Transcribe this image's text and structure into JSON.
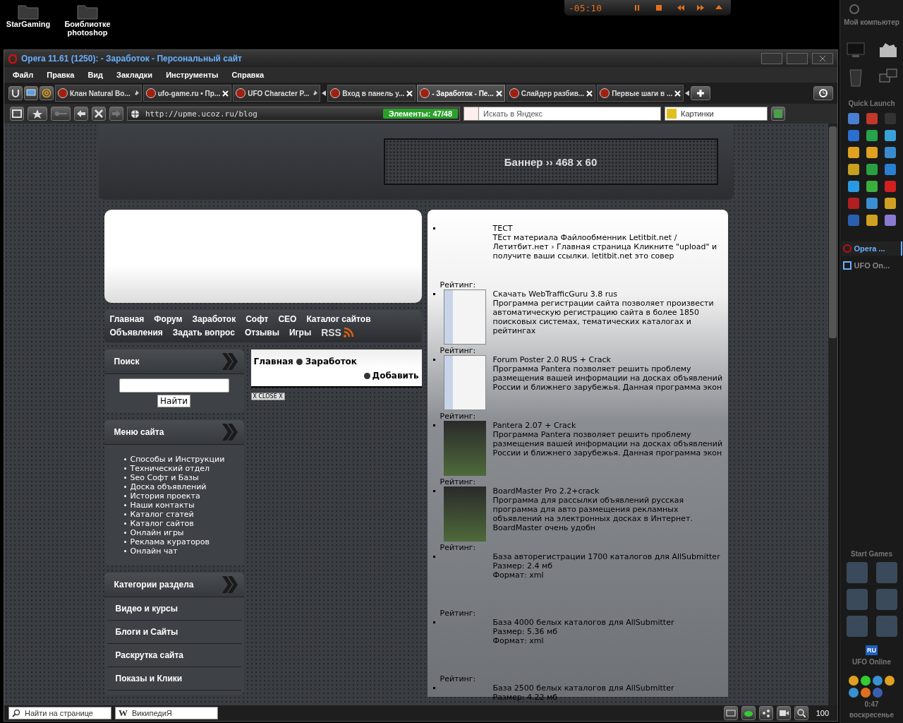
{
  "desktop_icons": [
    {
      "label": "StarGaming"
    },
    {
      "label": "Боиблиотке photoshop"
    }
  ],
  "media_player": {
    "time": "-05:10"
  },
  "window": {
    "title": "Opera 11.61 (1250): - Заработок - Персональный сайт"
  },
  "menu": [
    "Файл",
    "Правка",
    "Вид",
    "Закладки",
    "Инструменты",
    "Справка"
  ],
  "tabs": [
    {
      "label": "Клан Natural Bo...",
      "pinned": true,
      "selected": false
    },
    {
      "label": "ufo-game.ru • Пр...",
      "pinned": false,
      "selected": false
    },
    {
      "label": "UFO Character P...",
      "pinned": true,
      "selected": false
    },
    {
      "label": "Вход в панель у...",
      "pinned": false,
      "selected": false
    },
    {
      "label": "- Заработок - Пе...",
      "pinned": false,
      "selected": true
    },
    {
      "label": "Слайдер разбив...",
      "pinned": false,
      "selected": false
    },
    {
      "label": "Первые шаги в ...",
      "pinned": false,
      "selected": false
    }
  ],
  "address_bar": {
    "url": "http://upme.ucoz.ru/blog",
    "elements": "Элементы:  47/48"
  },
  "search_field": {
    "placeholder": "Искать в Яндекс"
  },
  "images_field": {
    "value": "Картинки"
  },
  "site": {
    "banner": "Баннер  ›› 468 x 60",
    "nav": [
      "Главная",
      "Форум",
      "Заработок",
      "Софт",
      "СЕО",
      "Каталог сайтов",
      "Объявления",
      "Задать вопрос",
      "Отзывы",
      "Игры"
    ],
    "rss": "RSS",
    "search_box": {
      "title": "Поиск",
      "button": "Найти"
    },
    "menu_box": {
      "title": "Меню сайта",
      "items": [
        "Способы и Инструкции",
        "Технический отдел",
        "Seo Софт и Базы",
        "Доска объявлений",
        "История проекта",
        "Наши контакты",
        "Каталог статей",
        "Каталог сайтов",
        "Онлайн игры",
        "Реклама кураторов",
        "Онлайн чат"
      ]
    },
    "categories_box": {
      "title": "Категории раздела",
      "items": [
        "Видео и курсы",
        "Блоги и Сайты",
        "Раскрутка сайта",
        "Показы и Клики"
      ]
    },
    "breadcrumb": [
      "Главная",
      "Заработок"
    ],
    "add_link": "Добавить",
    "close_button": "X CLOSE X",
    "entries": [
      {
        "kind": "text",
        "title": "ТЕСТ",
        "lines": [
          "ТЕст материала Файлообменник Letitbit.net / Летитбит.нет › Главная страница Кликните \"upload\" и получите ваши ссылки. letitbit.net это совер"
        ],
        "rating": "Рейтинг:"
      },
      {
        "kind": "screenshot",
        "title": "Скачать WebTrafficGuru 3.8 rus",
        "lines": [
          "Программа регистрации сайта позволяет произвести автоматическую регистрацию сайта в более 1850 поисковых системах, тематических каталогах и рейтингах"
        ],
        "rating": "Рейтинг:"
      },
      {
        "kind": "screenshot",
        "title": "Forum Poster 2.0 RUS + Crack",
        "lines": [
          "Программа Pantera позволяет решить проблему размещения вашей информации на досках объявлений России и ближнего зарубежья. Данная программа экон"
        ],
        "rating": "Рейтинг:"
      },
      {
        "kind": "photo",
        "title": "Pantera 2.07 + Crack",
        "lines": [
          "Программа Pantera позволяет решить проблему размещения вашей информации на досках объявлений России и ближнего зарубежья. Данная программа экон"
        ],
        "rating": "Рейтинг:"
      },
      {
        "kind": "photo",
        "title": "BoardMaster Pro 2.2+crack",
        "lines": [
          "Программа для рассылки объявлений русская программа для авто размещения рекламных объявлений на электронных досках в Интернет. BoardMaster очень удобн"
        ],
        "rating": "Рейтинг:"
      },
      {
        "kind": "text",
        "title": "База авторегистрации 1700 каталогов для AllSubmitter",
        "lines": [
          "Размер: 2.4 мб",
          "Формат: xml"
        ],
        "rating": "Рейтинг:"
      },
      {
        "kind": "text",
        "title": "База 4000 белых каталогов для AllSubmitter",
        "lines": [
          "Размер: 5.36 мб",
          "Формат: xml"
        ],
        "rating": "Рейтинг:"
      },
      {
        "kind": "text",
        "title": "База 2500 белых каталогов для AllSubmitter",
        "lines": [
          "Размер: 4.22 мб"
        ]
      }
    ]
  },
  "status_bar": {
    "find_placeholder": "Найти на странице",
    "wiki_icon": "W",
    "wiki_field": "ВикипедиЯ",
    "zoom": "100"
  },
  "dock": {
    "computer": "Мой компьютер",
    "quick_launch": "Quick Launch",
    "tasks": [
      {
        "label": "Opera ...",
        "selected": true
      },
      {
        "label": "UFO On...",
        "selected": false
      }
    ],
    "start_games": "Start Games",
    "lang": "RU",
    "ufo": "UFO Online",
    "time": "0:47",
    "day": "воскресенье"
  }
}
